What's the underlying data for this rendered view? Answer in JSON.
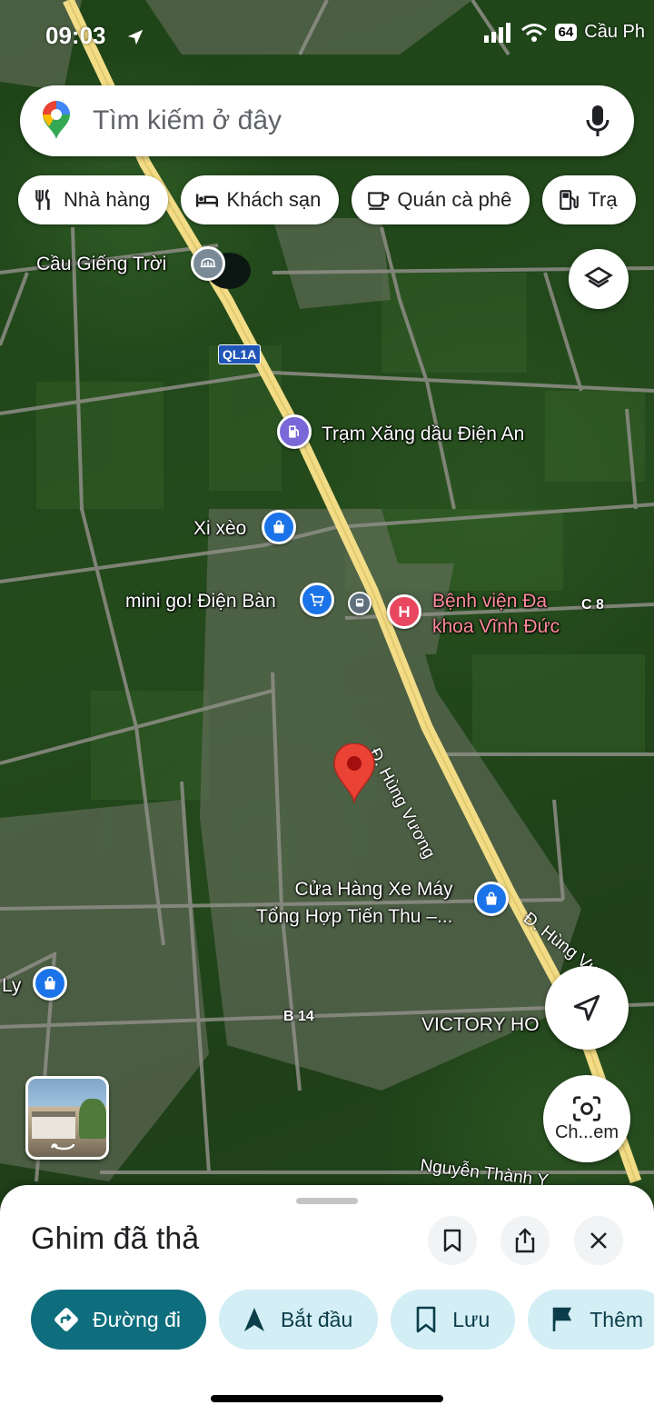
{
  "status": {
    "time": "09:03",
    "battery": "64",
    "right_label": "Cầu Ph"
  },
  "search": {
    "placeholder": "Tìm kiếm ở đây"
  },
  "chips": [
    {
      "label": "Nhà hàng",
      "icon": "utensils-icon"
    },
    {
      "label": "Khách sạn",
      "icon": "bed-icon"
    },
    {
      "label": "Quán cà phê",
      "icon": "coffee-icon"
    },
    {
      "label": "Trạ",
      "icon": "gas-pump-icon"
    }
  ],
  "map": {
    "pois": [
      {
        "label": "Cầu Giếng Trời",
        "icon": "bridge-icon"
      },
      {
        "label": "Trạm Xăng dầu Điện An",
        "icon": "gas-station-icon"
      },
      {
        "label": "Xi xèo",
        "icon": "shopping-bag-icon"
      },
      {
        "label": "mini go! Điện Bàn",
        "icon": "cart-icon"
      },
      {
        "label": "Bệnh viện Đa khoa Vĩnh Đức",
        "icon": "hospital-icon"
      },
      {
        "label": "Cửa Hàng Xe Máy Tổng Hợp Tiến Thu –...",
        "icon": "shopping-bag-icon"
      },
      {
        "label": "Ly",
        "icon": "shopping-bag-icon"
      },
      {
        "label": "VICTORY HO",
        "icon": ""
      }
    ],
    "roads": {
      "shield": "QL1A",
      "hung_vuong_1": "Đ. Hùng Vương",
      "hung_vuong_2": "Đ. Hùng Vương",
      "b14": "B 14",
      "c8": "C 8",
      "nguyen_thanh": "Nguyễn Thành Y"
    },
    "hospital_line1": "Bệnh viện Đa",
    "hospital_line2": "khoa Vĩnh Đức",
    "motorbike_line1": "Cửa Hàng Xe Máy",
    "motorbike_line2": "Tổng Hợp Tiến Thu –..."
  },
  "lens": {
    "label": "Ch...em"
  },
  "sheet": {
    "title": "Ghim đã thả",
    "actions": [
      {
        "label": "Đường đi",
        "icon": "directions-icon"
      },
      {
        "label": "Bắt đầu",
        "icon": "navigation-arrow-icon"
      },
      {
        "label": "Lưu",
        "icon": "bookmark-icon"
      },
      {
        "label": "Thêm",
        "icon": "flag-icon"
      }
    ]
  },
  "colors": {
    "primary": "#0e6e7e",
    "chip_bg": "#d3eef5",
    "pin": "#ea4335",
    "poi_blue": "#1a73e8",
    "hospital": "#e8475f"
  }
}
